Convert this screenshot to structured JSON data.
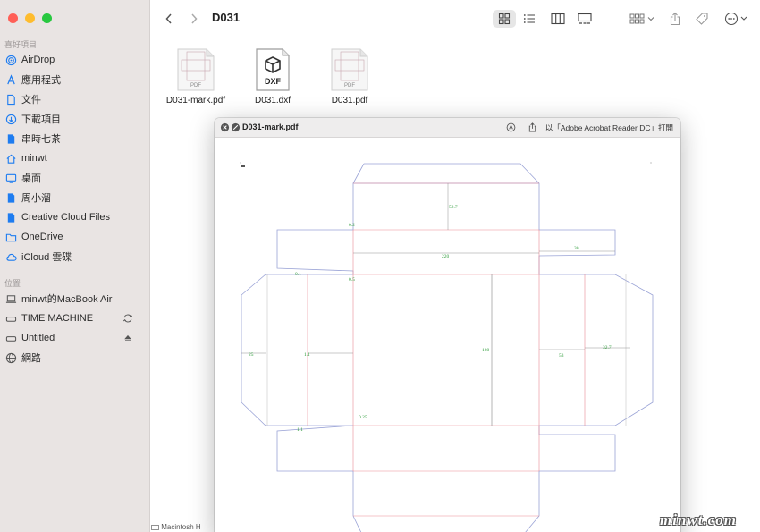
{
  "window": {
    "title": "D031"
  },
  "sidebar": {
    "favorites_title": "喜好項目",
    "favorites": [
      {
        "label": "AirDrop",
        "icon": "airdrop-icon"
      },
      {
        "label": "應用程式",
        "icon": "applications-icon"
      },
      {
        "label": "文件",
        "icon": "document-icon"
      },
      {
        "label": "下載項目",
        "icon": "download-icon"
      },
      {
        "label": "串時七茶",
        "icon": "file-icon"
      },
      {
        "label": "minwt",
        "icon": "home-icon"
      },
      {
        "label": "桌面",
        "icon": "desktop-icon"
      },
      {
        "label": "周小溜",
        "icon": "file-icon"
      },
      {
        "label": "Creative Cloud Files",
        "icon": "file-icon"
      },
      {
        "label": "OneDrive",
        "icon": "folder-icon"
      },
      {
        "label": "iCloud 雲碟",
        "icon": "cloud-icon"
      }
    ],
    "locations_title": "位置",
    "locations": [
      {
        "label": "minwt的MacBook Air",
        "icon": "laptop-icon"
      },
      {
        "label": "TIME MACHINE",
        "icon": "drive-icon"
      },
      {
        "label": "Untitled",
        "icon": "drive-icon"
      },
      {
        "label": "網路",
        "icon": "globe-icon"
      }
    ]
  },
  "files": [
    {
      "name": "D031-mark.pdf",
      "kind": "PDF"
    },
    {
      "name": "D031.dxf",
      "kind": "DXF"
    },
    {
      "name": "D031.pdf",
      "kind": "PDF"
    }
  ],
  "preview": {
    "title": "D031-mark.pdf",
    "open_with": "以「Adobe Acrobat Reader DC」打開",
    "dimensions": [
      "52.7",
      "0.2",
      "30",
      "220",
      "0.1",
      "0.5",
      "25",
      "1.1",
      "180",
      "53",
      "32.7",
      "0.25",
      "1.1"
    ]
  },
  "statusbar": {
    "path": "Macintosh H"
  },
  "watermark": "minwt.com",
  "colors": {
    "sidebar_bg": "#e9e4e3",
    "accent": "#1e7cf0",
    "dieline_blue": "#9aa3d6",
    "dieline_red": "#e98a95",
    "dim_green": "#2e9c3a"
  }
}
